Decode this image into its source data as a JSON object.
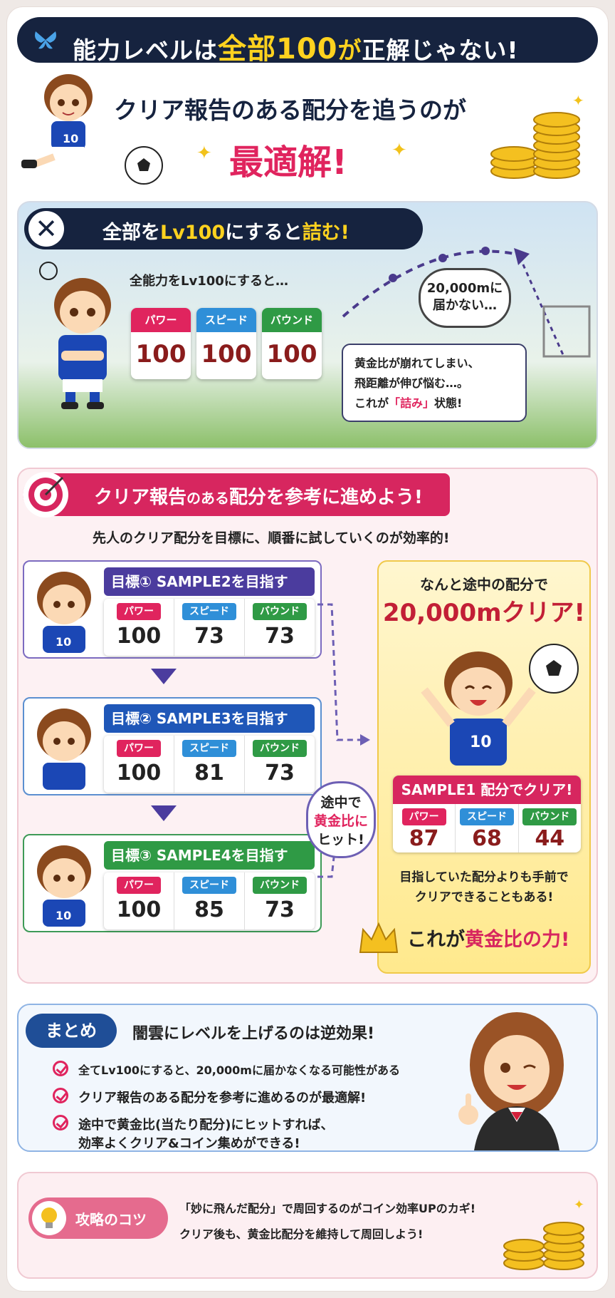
{
  "header": {
    "title_pre": "能力レベルは",
    "title_hl1": "全部100",
    "title_mid": "が",
    "title_post": "正解じゃない!",
    "sub_line": "クリア報告のある配分を追うのが",
    "sub_emph": "最適解!"
  },
  "bad": {
    "header_pre": "全部を",
    "header_hl": "Lv100",
    "header_mid": "にすると",
    "header_post": "詰む!",
    "caption": "全能力をLv100にすると…",
    "stats": [
      {
        "label": "パワー",
        "value": "100"
      },
      {
        "label": "スピード",
        "value": "100"
      },
      {
        "label": "バウンド",
        "value": "100"
      }
    ],
    "bubble": "20,000mに\n届かない…",
    "note1": "黄金比が崩れてしまい、",
    "note2": "飛距離が伸び悩む…。",
    "note3_pre": "これが",
    "note3_hl": "「詰み」",
    "note3_post": "状態!"
  },
  "plan": {
    "header_pre": "クリア報告",
    "header_mid": "のある",
    "header_post": "配分を参考に進めよう!",
    "lead": "先人のクリア配分を目標に、順番に試していくのが効率的!",
    "goals": [
      {
        "title": "目標① SAMPLE2を目指す",
        "stats": [
          {
            "label": "パワー",
            "value": "100"
          },
          {
            "label": "スピード",
            "value": "73"
          },
          {
            "label": "バウンド",
            "value": "73"
          }
        ]
      },
      {
        "title": "目標② SAMPLE3を目指す",
        "stats": [
          {
            "label": "パワー",
            "value": "100"
          },
          {
            "label": "スピード",
            "value": "81"
          },
          {
            "label": "バウンド",
            "value": "73"
          }
        ]
      },
      {
        "title": "目標③ SAMPLE4を目指す",
        "stats": [
          {
            "label": "パワー",
            "value": "100"
          },
          {
            "label": "スピード",
            "value": "85"
          },
          {
            "label": "バウンド",
            "value": "73"
          }
        ]
      }
    ],
    "hit_bubble_1": "途中で",
    "hit_bubble_2": "黄金比に",
    "hit_bubble_3": "ヒット!",
    "result_line1": "なんと途中の配分で",
    "result_line2": "20,000mクリア!",
    "result_title": "SAMPLE1 配分でクリア!",
    "result_stats": [
      {
        "label": "パワー",
        "value": "87"
      },
      {
        "label": "スピード",
        "value": "68"
      },
      {
        "label": "バウンド",
        "value": "44"
      }
    ],
    "result_note1": "目指していた配分よりも手前で",
    "result_note2": "クリアできることもある!",
    "power_pre": "これが",
    "power_hl": "黄金比の力!"
  },
  "summary": {
    "badge": "まとめ",
    "title": "闇雲にレベルを上げるのは逆効果!",
    "items": [
      "全てLv100にすると、20,000mに届かなくなる可能性がある",
      "クリア報告のある配分を参考に進めるのが最適解!",
      "途中で黄金比(当たり配分)にヒットすれば、",
      "効率よくクリア&コイン集めができる!"
    ]
  },
  "tips": {
    "badge": "攻略のコツ",
    "line1": "「妙に飛んだ配分」で周回するのがコイン効率UPのカギ!",
    "line2": "クリア後も、黄金比配分を維持して周回しよう!"
  }
}
